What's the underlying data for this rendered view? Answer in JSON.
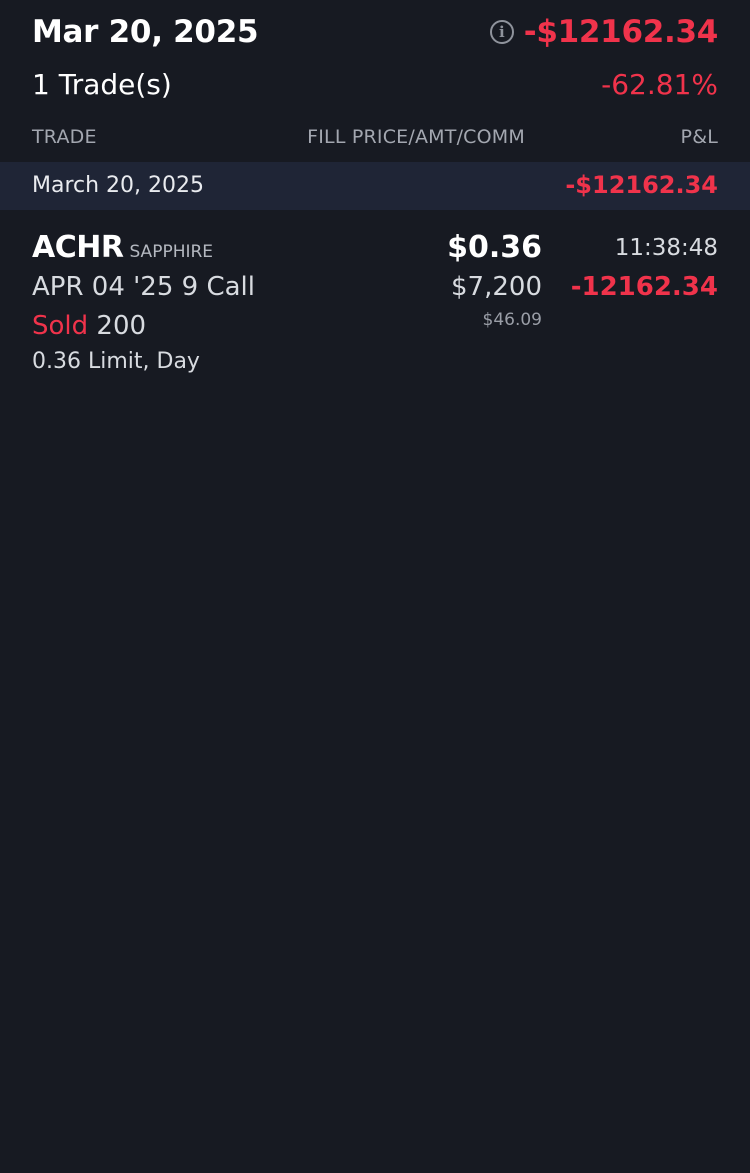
{
  "header": {
    "date": "Mar 20, 2025",
    "info_icon": "info-icon",
    "total_pnl": "-$12162.34",
    "trade_count": "1 Trade(s)",
    "pnl_percent": "-62.81%"
  },
  "columns": {
    "trade": "TRADE",
    "fill": "FILL PRICE/AMT/COMM",
    "pnl": "P&L"
  },
  "groups": [
    {
      "date_label": "March 20, 2025",
      "pnl": "-$12162.34",
      "trades": [
        {
          "symbol": "ACHR",
          "account": "SAPPHIRE",
          "contract": "APR 04 '25 9 Call",
          "side": "Sold",
          "quantity": "200",
          "order": "0.36 Limit, Day",
          "fill_price": "$0.36",
          "amount": "$7,200",
          "commission": "$46.09",
          "time": "11:38:48",
          "pnl": "-12162.34"
        }
      ]
    }
  ],
  "colors": {
    "background": "#171a22",
    "date_bar": "#1f2536",
    "negative": "#f0334b",
    "text": "#ffffff",
    "muted": "#a3a7b0"
  }
}
